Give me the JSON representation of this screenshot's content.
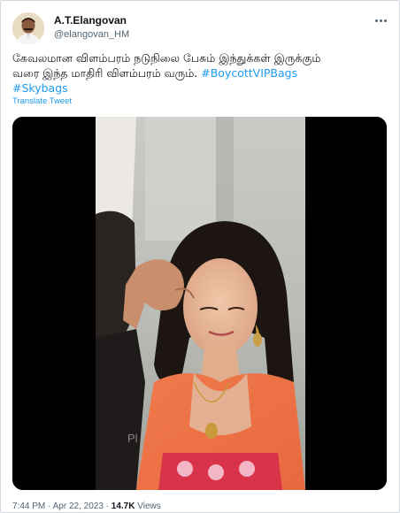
{
  "author": {
    "name": "A.T.Elangovan",
    "handle": "@elangovan_HM"
  },
  "tweet": {
    "line1": "கேவலமான விளம்பரம் நடுநிலை பேசும் இந்துக்கள் இருக்கும்",
    "line2_text": "வரை இந்த மாதிரி விளம்பரம் வரும். ",
    "hashtag1": "#BoycottVIPBags",
    "hashtag2": "#Skybags",
    "translate_label": "Translate Tweet"
  },
  "media": {
    "watermark": "Pl"
  },
  "meta": {
    "time": "7:44 PM",
    "separator": "·",
    "date": "Apr 22, 2023",
    "views_count": "14.7K",
    "views_label": "Views"
  },
  "icons": {
    "more": "more-horizontal-icon"
  }
}
